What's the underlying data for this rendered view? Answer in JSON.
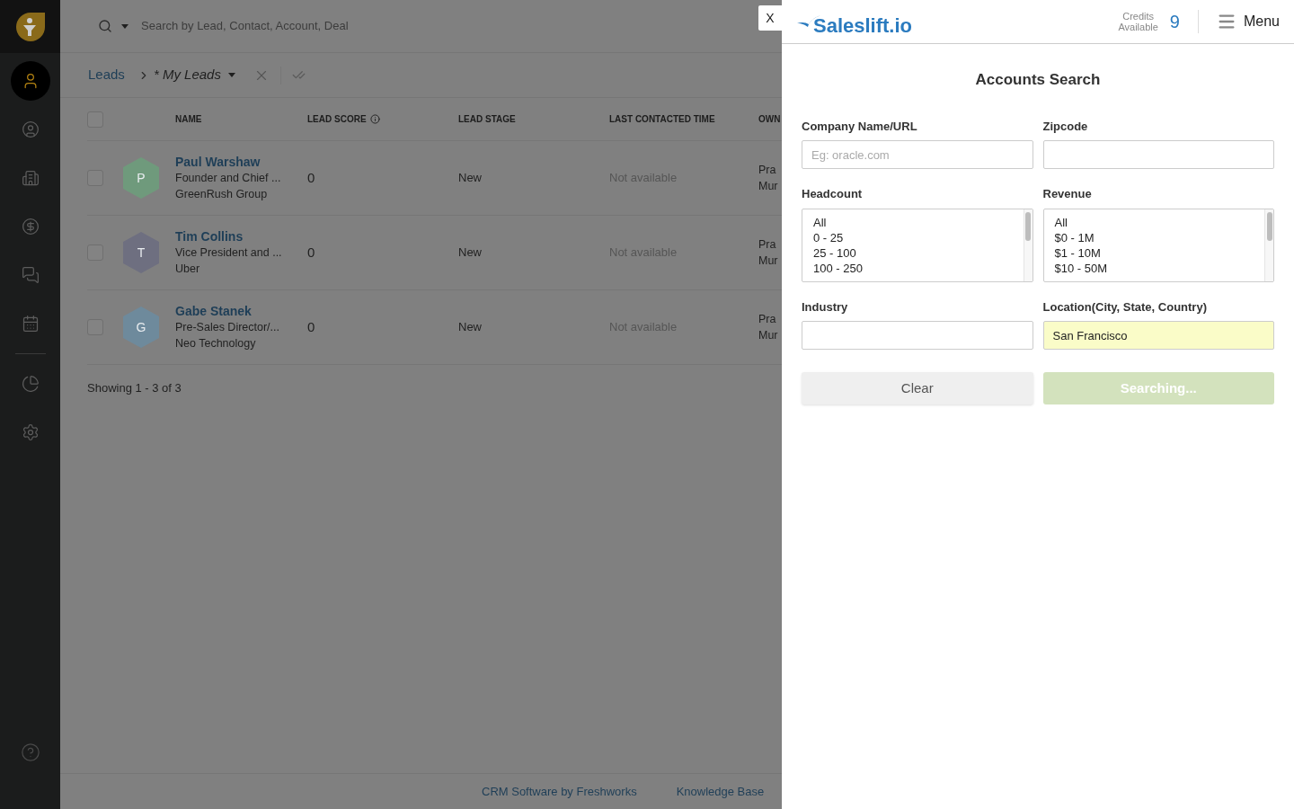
{
  "sidebar": {
    "items": [
      {
        "kind": "leads",
        "selected": true
      },
      {
        "kind": "contacts",
        "selected": false
      },
      {
        "kind": "accounts",
        "selected": false
      },
      {
        "kind": "deals",
        "selected": false
      },
      {
        "kind": "chat",
        "selected": false
      },
      {
        "kind": "calendar",
        "selected": false
      },
      {
        "kind": "reports",
        "selected": false
      },
      {
        "kind": "settings",
        "selected": false
      }
    ]
  },
  "search": {
    "placeholder": "Search by Lead, Contact, Account, Deal"
  },
  "breadcrumb": {
    "root": "Leads",
    "view": "* My Leads"
  },
  "table": {
    "select_all": {
      "checked": false
    },
    "columns": [
      "NAME",
      "LEAD SCORE",
      "LEAD STAGE",
      "LAST CONTACTED TIME",
      "OWN"
    ],
    "rows": [
      {
        "checked": false,
        "initial": "P",
        "color": "#6f9a7c",
        "name": "Paul Warshaw",
        "title": "Founder and Chief ...",
        "company": "GreenRush Group",
        "score": "0",
        "stage": "New",
        "last_contacted": "Not available",
        "owner": [
          "Pra",
          "Mur"
        ]
      },
      {
        "checked": false,
        "initial": "T",
        "color": "#6e6f80",
        "name": "Tim Collins",
        "title": "Vice President and ...",
        "company": "Uber",
        "score": "0",
        "stage": "New",
        "last_contacted": "Not available",
        "owner": [
          "Pra",
          "Mur"
        ]
      },
      {
        "checked": false,
        "initial": "G",
        "color": "#6e8a9c",
        "name": "Gabe Stanek",
        "title": "Pre-Sales Director/...",
        "company": "Neo Technology",
        "score": "0",
        "stage": "New",
        "last_contacted": "Not available",
        "owner": [
          "Pra",
          "Mur"
        ]
      }
    ],
    "summary": "Showing 1 - 3 of 3"
  },
  "footer": {
    "links": [
      "CRM Software by Freshworks",
      "Knowledge Base"
    ]
  },
  "panel": {
    "close": "X",
    "logo": "Saleslift.io",
    "credits_label": [
      "Credits",
      "Available"
    ],
    "credits": "9",
    "menu": "Menu",
    "title": "Accounts Search",
    "fields": [
      {
        "kind": "input",
        "label": "Company Name/URL",
        "placeholder": "Eg: oracle.com",
        "highlighted": false
      },
      {
        "kind": "input",
        "label": "Zipcode",
        "highlighted": false
      },
      {
        "kind": "list",
        "label": "Headcount",
        "options": [
          "All",
          "0 - 25",
          "25 - 100",
          "100 - 250"
        ]
      },
      {
        "kind": "list",
        "label": "Revenue",
        "options": [
          "All",
          "$0 - 1M",
          "$1 - 10M",
          "$10 - 50M"
        ]
      },
      {
        "kind": "input",
        "label": "Industry",
        "highlighted": false
      },
      {
        "kind": "input",
        "label": "Location(City, State, Country)",
        "value": "San Francisco",
        "highlighted": true
      }
    ],
    "buttons": [
      {
        "kind": "secondary",
        "label": "Clear",
        "disabled": false
      },
      {
        "kind": "primary",
        "label": "Searching...",
        "disabled": true
      }
    ]
  }
}
